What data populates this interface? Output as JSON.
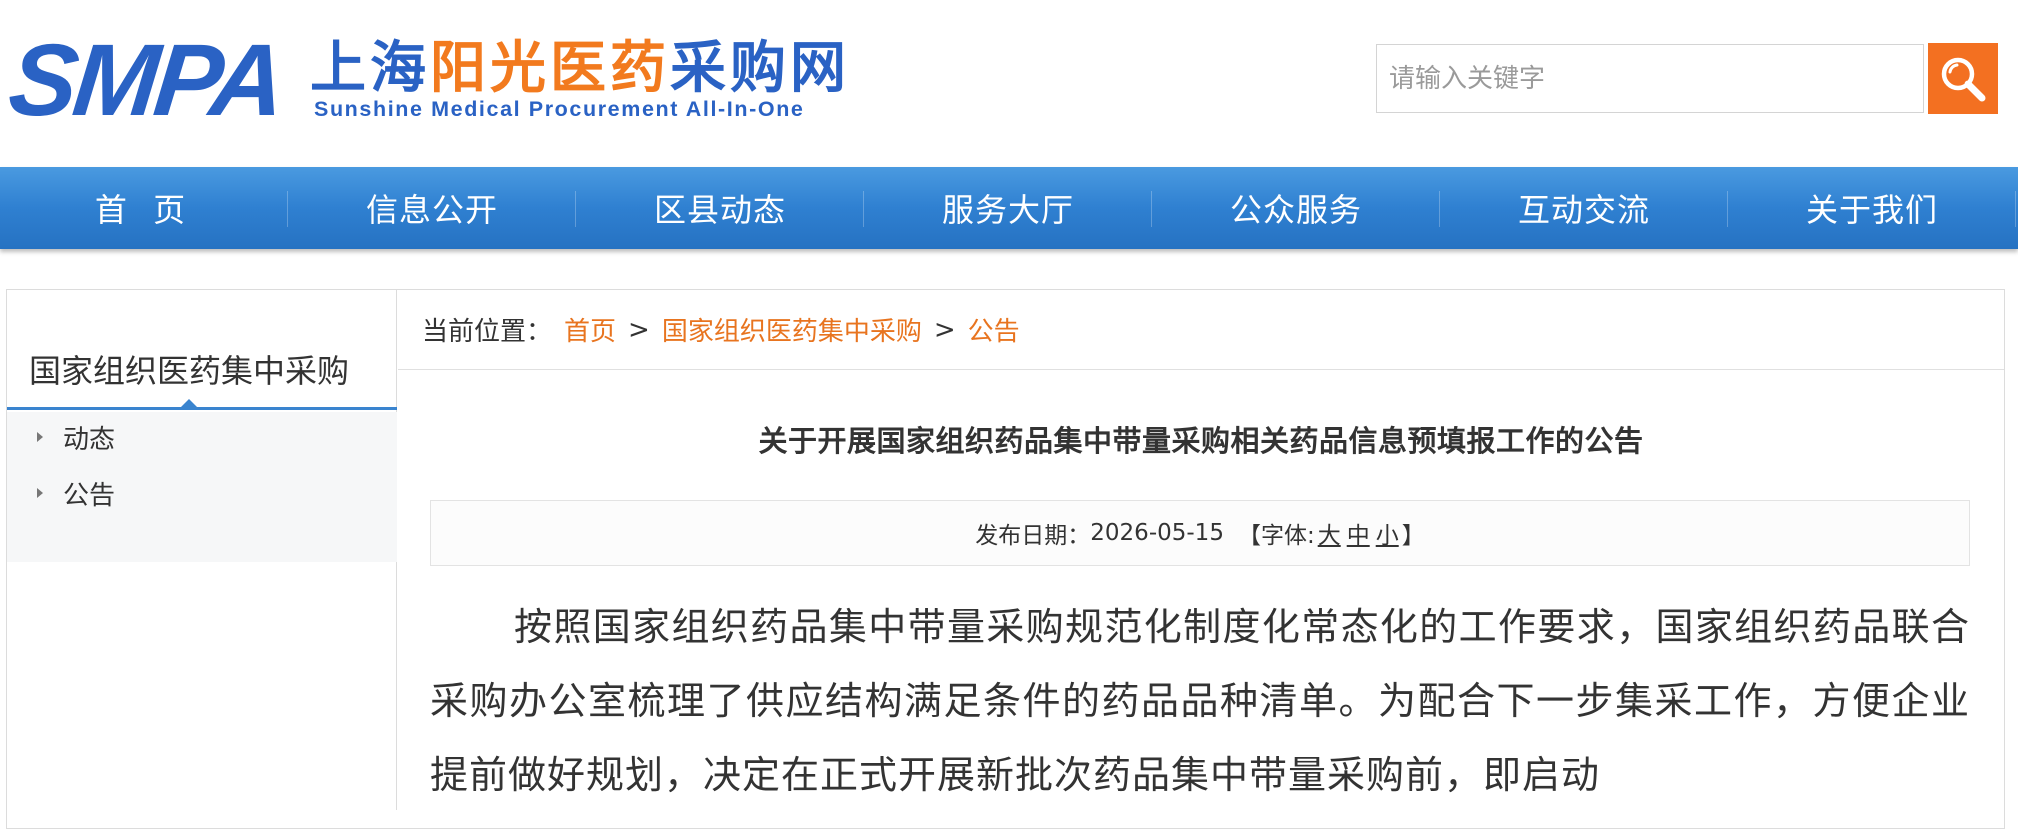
{
  "header": {
    "logo_mark": "SMPA",
    "logo_cn_part1": "上海",
    "logo_cn_part2": "阳光医药",
    "logo_cn_part3": "采购网",
    "logo_en": "Sunshine Medical Procurement All-In-One",
    "search_placeholder": "请输入关键字",
    "search_icon": "search-icon"
  },
  "nav": {
    "items": [
      "首 页",
      "信息公开",
      "区县动态",
      "服务大厅",
      "公众服务",
      "互动交流",
      "关于我们"
    ]
  },
  "sidebar": {
    "title": "国家组织医药集中采购",
    "items": [
      "动态",
      "公告"
    ]
  },
  "breadcrumb": {
    "prefix": "当前位置：",
    "links": [
      "首页",
      "国家组织医药集中采购",
      "公告"
    ],
    "separator": ">"
  },
  "article": {
    "title": "关于开展国家组织药品集中带量采购相关药品信息预填报工作的公告",
    "date_label": "发布日期：",
    "date": "2026-05-15",
    "font_label_open": "【字体:",
    "font_sizes": [
      "大",
      "中",
      "小"
    ],
    "font_label_close": "】",
    "body": "按照国家组织药品集中带量采购规范化制度化常态化的工作要求，国家组织药品联合采购办公室梳理了供应结构满足条件的药品品种清单。为配合下一步集采工作，方便企业提前做好规划，决定在正式开展新批次药品集中带量采购前，即启动"
  },
  "colors": {
    "brand_blue": "#2a62c4",
    "brand_orange": "#f27a1e",
    "nav_blue": "#2f80d1",
    "link_orange": "#e8741f"
  }
}
